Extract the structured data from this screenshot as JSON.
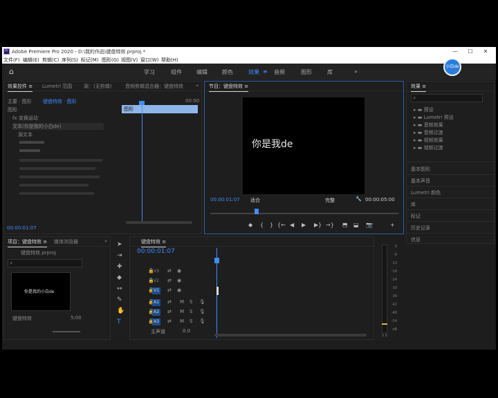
{
  "app": {
    "logo": "Pr",
    "title": "Adobe Premiere Pro 2020 - D:\\我的作品\\键盘特效.prproj *",
    "window_controls": [
      "—",
      "☐",
      "✕"
    ]
  },
  "menu": [
    "文件(F)",
    "编辑(E)",
    "剪辑(C)",
    "序列(S)",
    "标记(M)",
    "图形(G)",
    "视图(V)",
    "窗口(W)",
    "帮助(H)"
  ],
  "workspaces": {
    "items": [
      "学习",
      "组件",
      "编辑",
      "颜色",
      "效果",
      "音频",
      "图形",
      "库"
    ],
    "active": "效果",
    "more": "»",
    "avatar_text": "小白de"
  },
  "effect_controls": {
    "tabs": [
      "效果控件 ≡",
      "Lumetri 范围",
      "源：(无剪辑)",
      "音频剪辑混合器：键盘特效",
      "»"
    ],
    "clip_path": "主要 · 图形",
    "seq_path": "键盘特效 · 图形",
    "ruler_time": "00:00",
    "graphic_label": "图形",
    "rows": [
      "fx 变换运动",
      "文本(你是我的小白de)",
      "源文本"
    ],
    "timecode": "00:00:01:07"
  },
  "clip_track": {
    "label": "图形"
  },
  "program": {
    "title": "节目：键盘特效 ≡",
    "overlay_text": "你是我de",
    "timecode": "00:00:01:07",
    "fit": "适合",
    "quality": "完整",
    "duration": "00:00:05:00",
    "controls": [
      "◆",
      "{",
      "}",
      "{←",
      "◀",
      "▶",
      "▶}",
      "→}",
      "⬒",
      "⬓",
      "📷",
      "+"
    ]
  },
  "effects_panel": {
    "title": "效果 ≡",
    "items": [
      "预设",
      "Lumetri 预设",
      "音频效果",
      "音频过渡",
      "视频效果",
      "视频过渡"
    ],
    "side_items": [
      "基本图形",
      "基本声音",
      "Lumetri 颜色",
      "库",
      "标记",
      "历史记录",
      "信息"
    ]
  },
  "project": {
    "tabs": [
      "项目：键盘特效 ≡",
      "媒体浏览器",
      "»"
    ],
    "project_file": "键盘特效.prproj",
    "thumb_text": "你是我的小白de",
    "clip_name": "键盘特效",
    "clip_duration": "5:00"
  },
  "timeline": {
    "title": "键盘特效 ≡",
    "timecode": "00:00:01:07",
    "video_tracks": [
      "V3",
      "V2",
      "V1"
    ],
    "audio_tracks": [
      "A1",
      "A2",
      "A3"
    ],
    "master": "主声道",
    "master_value": "0.0"
  },
  "audio_meter": {
    "scale": [
      "0",
      "-6",
      "-12",
      "-18",
      "-24",
      "-30",
      "-36",
      "-42",
      "-48",
      "-54",
      "dB"
    ],
    "footer": "S S"
  }
}
